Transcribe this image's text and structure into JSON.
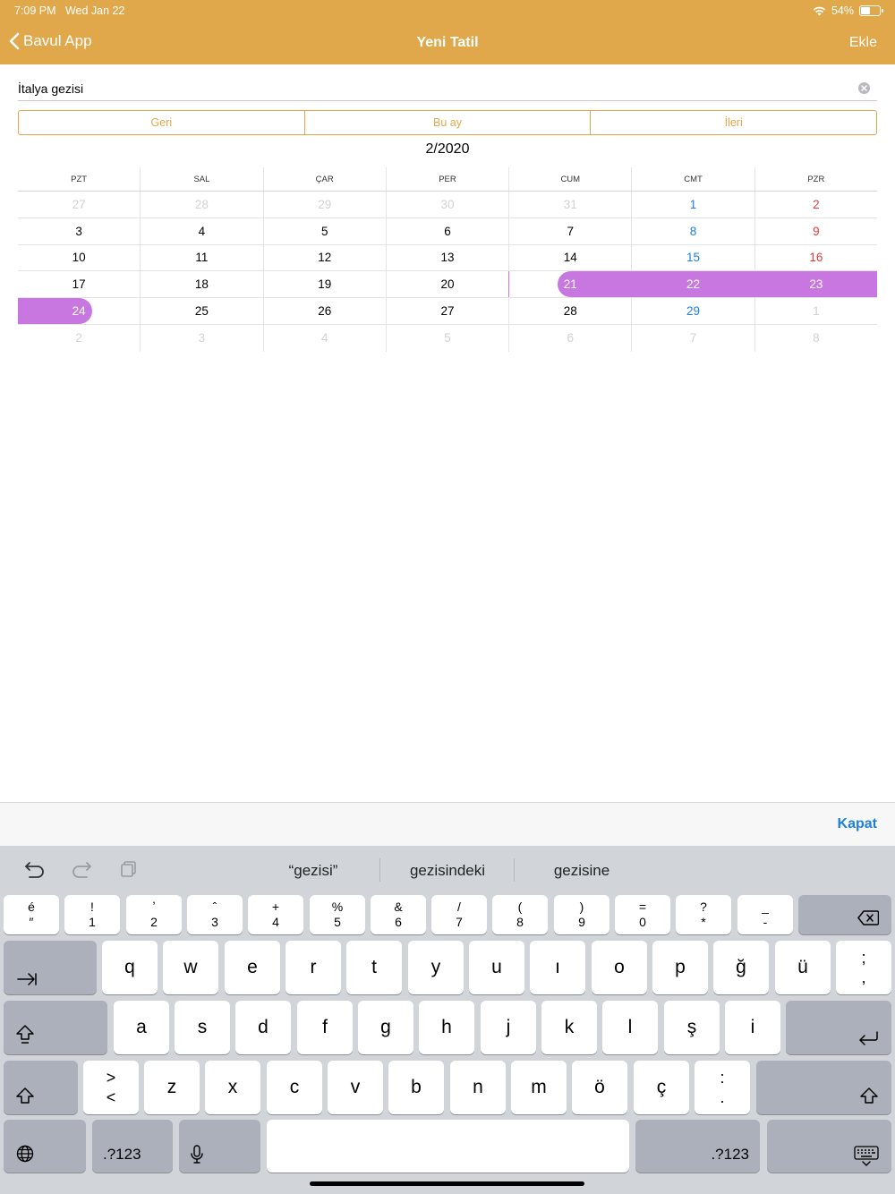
{
  "status_bar": {
    "time": "7:09 PM",
    "date": "Wed Jan 22",
    "battery": "54%",
    "battery_level": 0.54
  },
  "nav": {
    "back_label": "Bavul App",
    "title": "Yeni Tatil",
    "add_label": "Ekle"
  },
  "name_field": {
    "value": "İtalya gezisi"
  },
  "segments": [
    "Geri",
    "Bu ay",
    "İleri"
  ],
  "month_label": "2/2020",
  "calendar": {
    "weekdays": [
      "PZT",
      "SAL",
      "ÇAR",
      "PER",
      "CUM",
      "CMT",
      "PZR"
    ],
    "weeks": [
      [
        "27",
        "28",
        "29",
        "30",
        "31",
        "1",
        "2"
      ],
      [
        "3",
        "4",
        "5",
        "6",
        "7",
        "8",
        "9"
      ],
      [
        "10",
        "11",
        "12",
        "13",
        "14",
        "15",
        "16"
      ],
      [
        "17",
        "18",
        "19",
        "20",
        "21",
        "22",
        "23"
      ],
      [
        "24",
        "25",
        "26",
        "27",
        "28",
        "29",
        "1"
      ],
      [
        "2",
        "3",
        "4",
        "5",
        "6",
        "7",
        "8"
      ]
    ]
  },
  "colors": {
    "accent": "#e0a84a",
    "selection": "#c977e0",
    "saturday": "#1f7fe0",
    "sunday": "#e23a3a",
    "link": "#1f7fe0"
  },
  "keyboard_toolbar": {
    "close_label": "Kapat"
  },
  "keyboard": {
    "suggestions": [
      "“gezisi”",
      "gezisindeki",
      "gezisine"
    ],
    "row_numbers": [
      {
        "top": "é",
        "bottom": "″"
      },
      {
        "top": "!",
        "bottom": "1"
      },
      {
        "top": "ʼ",
        "bottom": "2"
      },
      {
        "top": "ˆ",
        "bottom": "3"
      },
      {
        "top": "+",
        "bottom": "4"
      },
      {
        "top": "%",
        "bottom": "5"
      },
      {
        "top": "&",
        "bottom": "6"
      },
      {
        "top": "/",
        "bottom": "7"
      },
      {
        "top": "(",
        "bottom": "8"
      },
      {
        "top": ")",
        "bottom": "9"
      },
      {
        "top": "=",
        "bottom": "0"
      },
      {
        "top": "?",
        "bottom": "*"
      },
      {
        "top": "_",
        "bottom": "-"
      }
    ],
    "row_q": [
      "q",
      "w",
      "e",
      "r",
      "t",
      "y",
      "u",
      "ı",
      "o",
      "p",
      "ğ",
      "ü"
    ],
    "row_q_extra": {
      "top": ";",
      "bottom": ","
    },
    "row_a": [
      "a",
      "s",
      "d",
      "f",
      "g",
      "h",
      "j",
      "k",
      "l",
      "ş",
      "i"
    ],
    "row_z_extra": {
      "top": ">",
      "bottom": "<"
    },
    "row_z": [
      "z",
      "x",
      "c",
      "v",
      "b",
      "n",
      "m",
      "ö",
      "ç"
    ],
    "row_z_punct": {
      "top": ":",
      "bottom": "."
    },
    "num_label": ".?123"
  }
}
